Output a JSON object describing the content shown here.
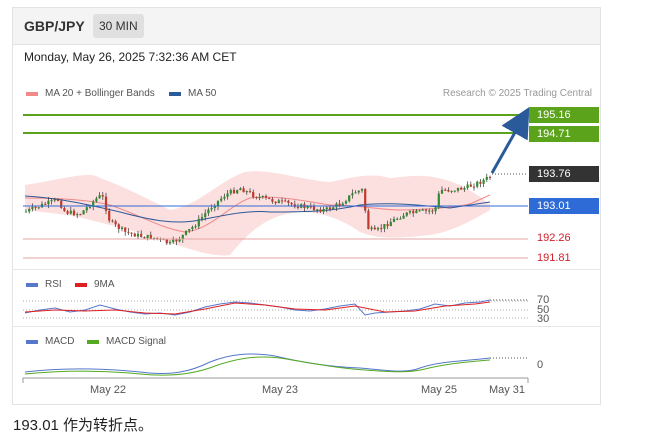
{
  "header": {
    "symbol": "GBP/JPY",
    "timeframe": "30 MIN"
  },
  "timestamp": "Monday, May 26, 2025 7:32:36 AM CET",
  "legend_main": [
    {
      "label": "MA 20 + Bollinger Bands",
      "color": "#f08a8a"
    },
    {
      "label": "MA 50",
      "color": "#2c5a9a"
    }
  ],
  "credit": "Research © 2025 Trading Central",
  "price_levels": {
    "resistance_2": "195.16",
    "resistance_1": "194.71",
    "last": "193.76",
    "pivot": "193.01",
    "support_1": "192.26",
    "support_2": "191.81"
  },
  "colors": {
    "green": "#5ba31b",
    "blue": "#2f6bd6",
    "red": "#d0202a",
    "dark": "#333333",
    "arrow": "#2a5a9a"
  },
  "rsi": {
    "legend": [
      {
        "label": "RSI",
        "color": "#5577cc"
      },
      {
        "label": "9MA",
        "color": "#e02020"
      }
    ],
    "levels": [
      "70",
      "50",
      "30"
    ]
  },
  "macd": {
    "legend": [
      {
        "label": "MACD",
        "color": "#5577cc"
      },
      {
        "label": "MACD Signal",
        "color": "#55aa22"
      }
    ],
    "level": "0"
  },
  "x_axis": [
    "May 22",
    "May 23",
    "May 25",
    "May 31"
  ],
  "footer": "193.01 作为转折点。"
}
